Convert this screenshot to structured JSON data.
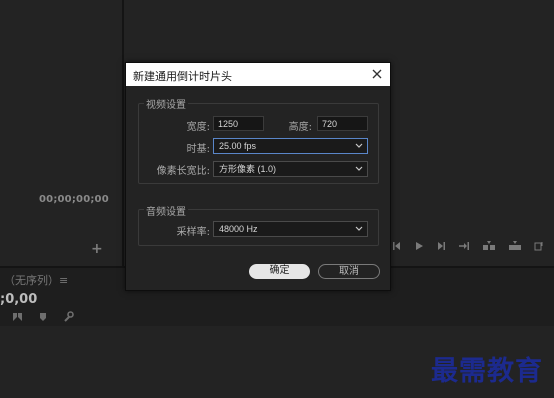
{
  "editor": {
    "source_timecode": "00;00;00;00",
    "sequence_label": "（无序列）≡",
    "timeline_timecode": ";0,00",
    "plus_icon": "plus-icon",
    "transport_icons": [
      "step-back-icon",
      "play-icon",
      "step-forward-icon",
      "go-to-end-icon",
      "insert-icon",
      "overwrite-icon",
      "more-icon"
    ],
    "tool_icons": [
      "snap-icon",
      "marker-icon",
      "wrench-icon"
    ]
  },
  "dialog": {
    "title": "新建通用倒计时片头",
    "close_icon": "close-icon",
    "video": {
      "group_title": "视频设置",
      "width_label": "宽度:",
      "width_value": "1250",
      "height_label": "高度:",
      "height_value": "720",
      "timebase_label": "时基:",
      "timebase_value": "25.00 fps",
      "par_label": "像素长宽比:",
      "par_value": "方形像素 (1.0)"
    },
    "audio": {
      "group_title": "音频设置",
      "samplerate_label": "采样率:",
      "samplerate_value": "48000 Hz"
    },
    "ok_label": "确定",
    "cancel_label": "取消",
    "colors": {
      "focus": "#5a86c9",
      "ok_bg": "#e6e6e6",
      "panel": "#232323"
    }
  },
  "watermark": {
    "text": "最需教育",
    "color": "#1c2a8e"
  }
}
